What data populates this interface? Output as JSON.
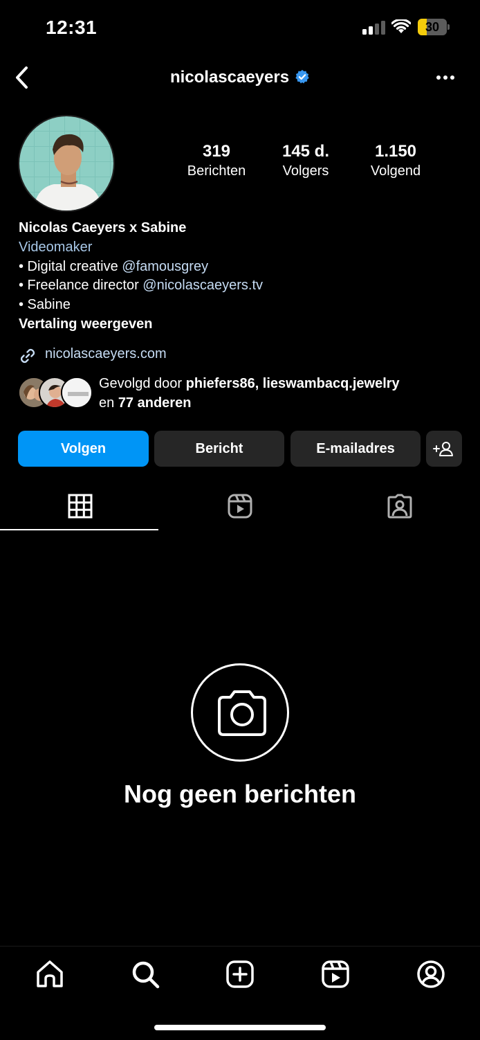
{
  "status_bar": {
    "time": "12:31",
    "battery": "30",
    "battery_level": 0.3,
    "signal_icon": "cellular-signal-icon",
    "wifi_icon": "wifi-icon"
  },
  "header": {
    "username": "nicolascaeyers",
    "back_icon": "chevron-left-icon",
    "verified_icon": "verified-badge-icon",
    "more_icon": "more-horizontal-icon"
  },
  "stats": [
    {
      "value": "319",
      "label": "Berichten"
    },
    {
      "value": "145 d.",
      "label": "Volgers"
    },
    {
      "value": "1.150",
      "label": "Volgend"
    }
  ],
  "bio": {
    "name": "Nicolas Caeyers x Sabine",
    "category": "Videomaker",
    "line1_prefix": "• Digital creative ",
    "line1_mention": "@famousgrey",
    "line2_prefix": "• Freelance director ",
    "line2_mention": "@nicolascaeyers.tv",
    "line3": "• Sabine",
    "translate": "Vertaling weergeven",
    "link": "nicolascaeyers.com",
    "link_icon": "link-icon"
  },
  "followed_by": {
    "prefix": "Gevolgd door ",
    "names": "phiefers86, lieswambacq.jewelry",
    "middle": " en ",
    "count": "77 anderen"
  },
  "actions": {
    "follow": "Volgen",
    "message": "Bericht",
    "email": "E-mailadres",
    "suggest_icon": "add-person-icon"
  },
  "tabs": [
    {
      "icon": "grid-icon",
      "active": true
    },
    {
      "icon": "reels-icon",
      "active": false
    },
    {
      "icon": "tagged-icon",
      "active": false
    }
  ],
  "empty_state": {
    "text": "Nog geen berichten",
    "icon": "camera-icon"
  },
  "bottom_nav": [
    {
      "icon": "home-icon"
    },
    {
      "icon": "search-icon"
    },
    {
      "icon": "create-icon"
    },
    {
      "icon": "reels-icon"
    },
    {
      "icon": "profile-icon"
    }
  ],
  "colors": {
    "background": "#000000",
    "follow_button": "#0095f6",
    "secondary_button": "#262626",
    "link": "#c6dcf4",
    "battery": "#f5cc0b",
    "verified": "#3897f0"
  }
}
